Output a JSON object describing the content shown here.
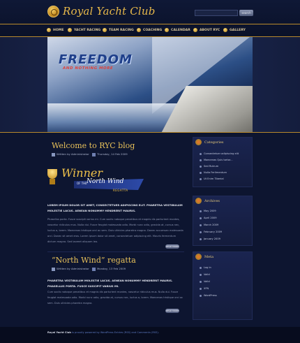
{
  "header": {
    "title": "Royal Yacht Club",
    "search_placeholder": "",
    "search_button": "search"
  },
  "nav": [
    {
      "label": "HOME"
    },
    {
      "label": "YACHT RACING"
    },
    {
      "label": "TEAM RACING"
    },
    {
      "label": "COACHING"
    },
    {
      "label": "CALENDAR"
    },
    {
      "label": "ABOUT RYC"
    },
    {
      "label": "GALLERY"
    }
  ],
  "hero": {
    "title": "FREEDOM",
    "subtitle": "AND NOTHING MORE"
  },
  "posts": [
    {
      "title": "Welcome to RYC blog",
      "author": "Written by Administrator",
      "date": "Thursday, 14 Feb 2009",
      "graphic": {
        "winner": "Winner",
        "of_the": "OF THE",
        "name": "North Wind",
        "regatta": "REGATTA"
      },
      "lead": "LOREM IPSUM DOLOR SIT AMET, CONSECTETUER ADIPISCING ELIT. PHARETRA VESTIBULUM MOLESTIE LACUS. AENEAN NONUMMY HENDRERIT MAURIS.",
      "body": "Phasellus porta. Fusce suscipit varius mi. Cum sociis natoque penatibus et magnis dis parturient montes, nascetur ridiculus mus. Nulla dui. Fusce feugiat malesuada odio. Morbi nunc odio, gravida at, cursus nec, luctus a, lorem. Maecenas tristique orci ac sem. Duis ultricies pharetra magna. Donec accumsan malesuada orci. Donec sit amet eros. Lorem ipsum dolor sit amet, consectetuer adipiscing elit. Mauris fermentum dictum magna. Sed laoreet aliquam leo.",
      "more": "READ MORE"
    },
    {
      "title": "“North Wind” regatta",
      "author": "Written by Administrator",
      "date": "Monday, 13 Feb 2009",
      "lead": "PHARETRA VESTIBULUM MOLESTIE LACUS. AENEAN NONUMMY HENDRERIT MAURIS. PHASELLUS PORTA. FUSCE SUSCIPIT VARIUS MI.",
      "body": "Cum sociis natoque penatibus et magnis dis parturient montes, nascetur ridiculus mus. Nulla dui. Fusce feugiat malesuada odio. Morbi nunc odio, gravida at, cursus nec, luctus a, lorem. Maecenas tristique orci ac sem. Duis ultricies pharetra magna.",
      "more": "READ MORE"
    }
  ],
  "sidebar": [
    {
      "heading": "Categories",
      "items": [
        "Consectetuer adipiscing elit",
        "Maecenas Quis tortor...",
        "Sed Rutrum",
        "Nulla Ferlimentum",
        "Ut Enim Tiberial"
      ]
    },
    {
      "heading": "Archives",
      "items": [
        "May 2009",
        "April 2009",
        "March 2009",
        "February 2009",
        "January 2009"
      ]
    },
    {
      "heading": "Meta",
      "items": [
        "Log in",
        "Valid",
        "Valid",
        "XFN",
        "WordPress"
      ]
    }
  ],
  "footer": {
    "brand": "Royal Yacht Club",
    "text": "is proudly powered by WordPress Entries (RSS) and Comments (RSS)."
  }
}
